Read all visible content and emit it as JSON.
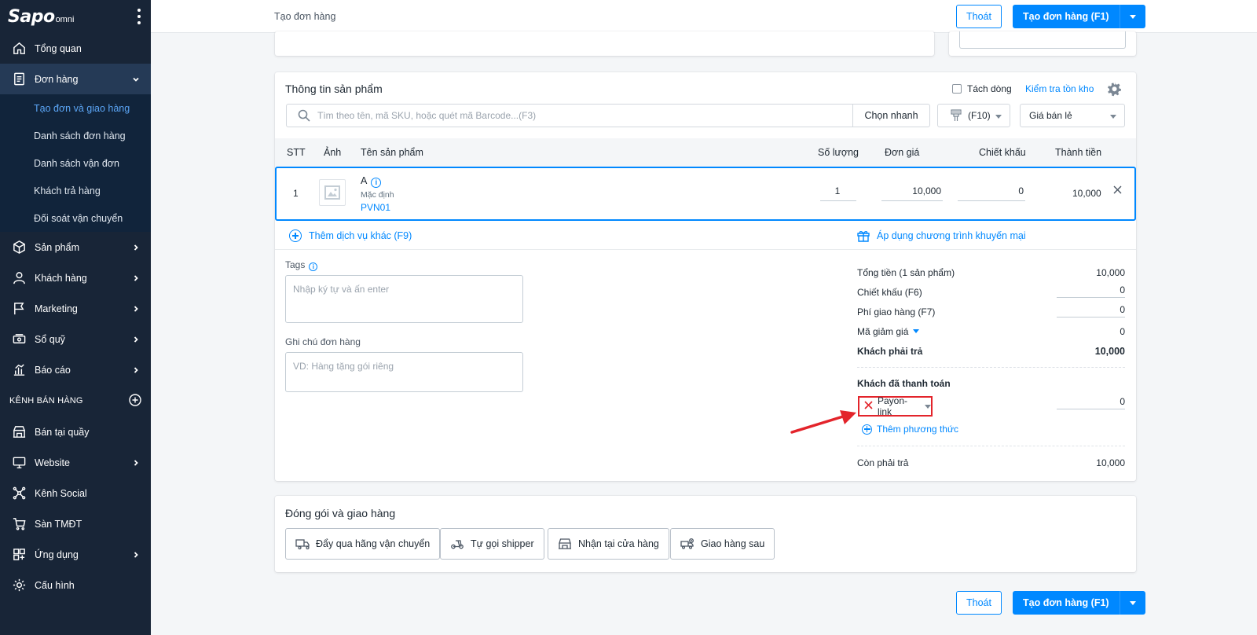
{
  "sidebar": {
    "logo": {
      "main": "Sapo",
      "sub": "omni"
    },
    "items": [
      {
        "label": "Tổng quan",
        "icon": "home-icon"
      },
      {
        "label": "Đơn hàng",
        "icon": "order-icon"
      },
      {
        "label": "Sản phẩm",
        "icon": "box-icon"
      },
      {
        "label": "Khách hàng",
        "icon": "user-icon"
      },
      {
        "label": "Marketing",
        "icon": "flag-icon"
      },
      {
        "label": "Sổ quỹ",
        "icon": "cash-icon"
      },
      {
        "label": "Báo cáo",
        "icon": "chart-icon"
      }
    ],
    "order_sub": [
      "Tạo đơn và giao hàng",
      "Danh sách đơn hàng",
      "Danh sách vận đơn",
      "Khách trả hàng",
      "Đối soát vận chuyển"
    ],
    "channel_header": "KÊNH BÁN HÀNG",
    "channels": [
      {
        "label": "Bán tại quầy",
        "icon": "store-icon"
      },
      {
        "label": "Website",
        "icon": "monitor-icon"
      },
      {
        "label": "Kênh Social",
        "icon": "social-icon"
      },
      {
        "label": "Sàn TMĐT",
        "icon": "cart-icon"
      },
      {
        "label": "Ứng dụng",
        "icon": "apps-icon"
      },
      {
        "label": "Cấu hình",
        "icon": "gear-icon"
      }
    ]
  },
  "header": {
    "title": "Tạo đơn hàng",
    "exit_label": "Thoát",
    "create_label": "Tạo đơn hàng (F1)"
  },
  "product_card": {
    "title": "Thông tin sản phẩm",
    "split_line_label": "Tách dòng",
    "check_stock_label": "Kiểm tra tồn kho",
    "search_placeholder": "Tìm theo tên, mã SKU, hoặc quét mã Barcode...(F3)",
    "quick_pick_label": "Chọn nhanh",
    "f10_label": "(F10)",
    "price_list": "Giá bán lẻ",
    "columns": {
      "stt": "STT",
      "image": "Ảnh",
      "name": "Tên sản phẩm",
      "qty": "Số lượng",
      "unit_price": "Đơn giá",
      "discount": "Chiết khấu",
      "total": "Thành tiền"
    },
    "row": {
      "stt": "1",
      "name": "A",
      "variant": "Mặc định",
      "sku": "PVN01",
      "qty": "1",
      "unit_price": "10,000",
      "discount": "0",
      "total": "10,000"
    },
    "add_service_label": "Thêm dịch vụ khác (F9)",
    "promotion_label": "Áp dụng chương trình khuyến mại",
    "tags_label": "Tags",
    "tags_placeholder": "Nhập ký tự và ấn enter",
    "note_label": "Ghi chú đơn hàng",
    "note_placeholder": "VD: Hàng tặng gói riêng"
  },
  "summary": {
    "total_label": "Tổng tiền (1 sản phẩm)",
    "total_value": "10,000",
    "discount_label": "Chiết khấu (F6)",
    "discount_value": "0",
    "shipping_label": "Phí giao hàng (F7)",
    "shipping_value": "0",
    "coupon_label": "Mã giảm giá",
    "coupon_value": "0",
    "payable_label": "Khách phải trả",
    "payable_value": "10,000",
    "paid_label": "Khách đã thanh toán",
    "payment_method": "Payon-link",
    "paid_value": "0",
    "add_method_label": "Thêm phương thức",
    "remaining_label": "Còn phải trả",
    "remaining_value": "10,000"
  },
  "shipping_card": {
    "title": "Đóng gói và giao hàng",
    "options": [
      "Đẩy qua hãng vận chuyển",
      "Tự gọi shipper",
      "Nhận tại cửa hàng",
      "Giao hàng sau"
    ]
  },
  "colors": {
    "accent": "#0088ff",
    "sidebar": "#182537",
    "highlight": "#e3242b"
  }
}
